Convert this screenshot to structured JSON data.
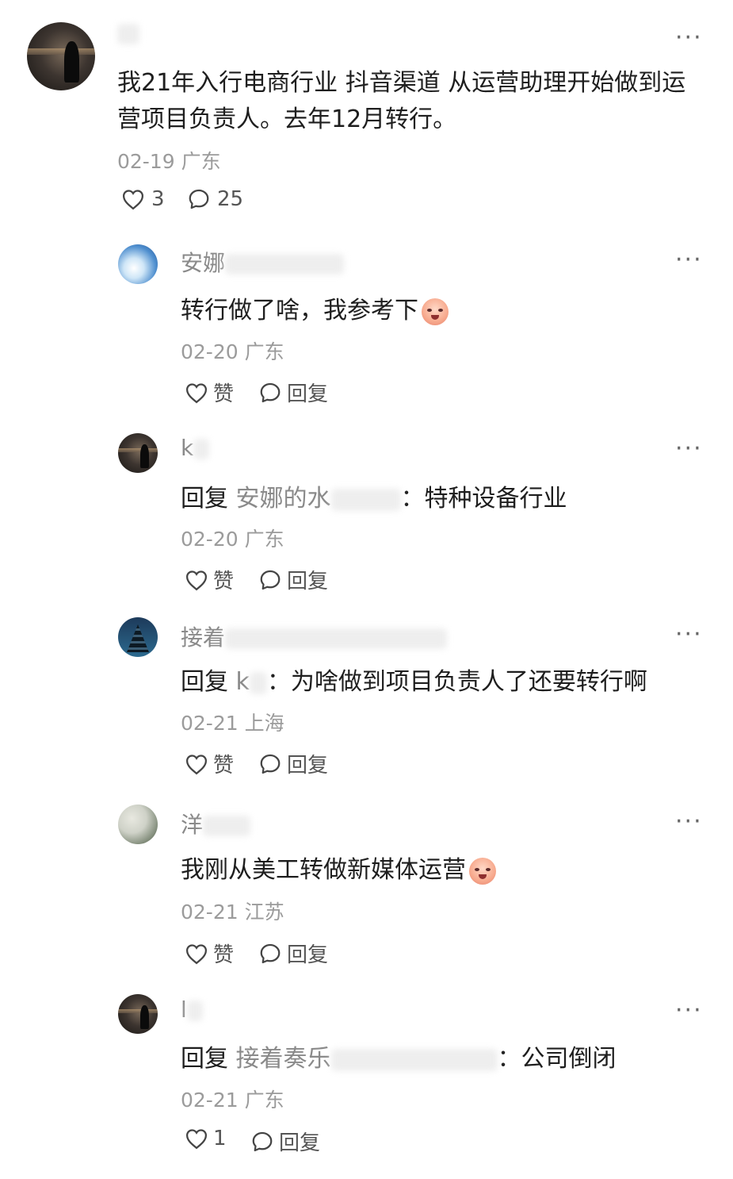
{
  "post": {
    "author_name": "",
    "content_line1": "我21年入行电商行业 抖音渠道 从运营助理开始做到运",
    "content_line2": "营项目负责人。去年12月转行。",
    "date": "02-19",
    "location": "广东",
    "like_count": "3",
    "comment_count": "25",
    "more": "···"
  },
  "replies": [
    {
      "name_visible": "安娜",
      "text": "转行做了啥，我参考下",
      "date": "02-20",
      "location": "广东",
      "like_label": "赞",
      "reply_label": "回复",
      "more": "···"
    },
    {
      "name_visible": "k",
      "reply_prefix": "回复",
      "reply_to": "安娜的水",
      "text": "：特种设备行业",
      "date": "02-20",
      "location": "广东",
      "like_label": "赞",
      "reply_label": "回复",
      "more": "···"
    },
    {
      "name_visible": "接着",
      "reply_prefix": "回复",
      "reply_to": "k",
      "text": "：为啥做到项目负责人了还要转行啊",
      "date": "02-21",
      "location": "上海",
      "like_label": "赞",
      "reply_label": "回复",
      "more": "···"
    },
    {
      "name_visible": "洋",
      "text": "我刚从美工转做新媒体运营",
      "date": "02-21",
      "location": "江苏",
      "like_label": "赞",
      "reply_label": "回复",
      "more": "···"
    },
    {
      "name_visible": "l",
      "reply_prefix": "回复",
      "reply_to": "接着奏乐",
      "text": "：公司倒闭",
      "date": "02-21",
      "location": "广东",
      "like_label": "1",
      "reply_label": "回复",
      "more": "···"
    }
  ],
  "icons": {
    "like": "heart-icon",
    "comment": "comment-bubble-icon",
    "more": "more-dots-icon",
    "emoji": "crying-emoji-icon"
  },
  "colors": {
    "text": "#1e1e1e",
    "secondary": "#9b9b9b",
    "name": "#8a8a8a"
  }
}
